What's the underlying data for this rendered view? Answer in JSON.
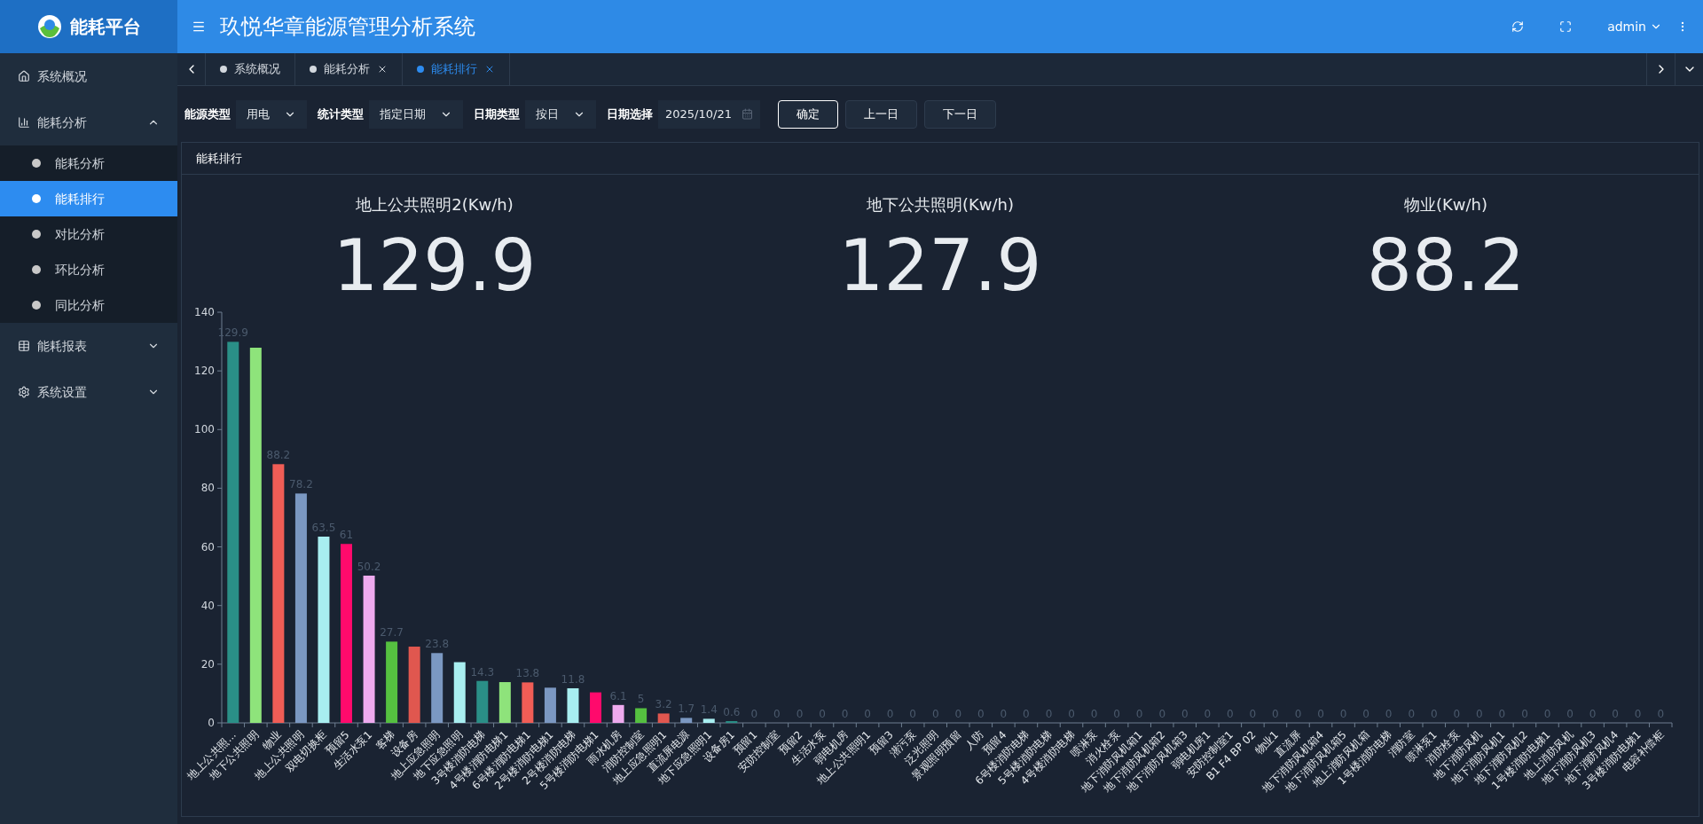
{
  "logo": {
    "text": "能耗平台"
  },
  "header": {
    "title": "玖悦华章能源管理分析系统",
    "user": "admin"
  },
  "sidebar": {
    "items": [
      {
        "label": "系统概况"
      },
      {
        "label": "能耗分析",
        "expanded": true,
        "children": [
          {
            "label": "能耗分析",
            "selected": false
          },
          {
            "label": "能耗排行",
            "selected": true
          },
          {
            "label": "对比分析",
            "selected": false
          },
          {
            "label": "环比分析",
            "selected": false
          },
          {
            "label": "同比分析",
            "selected": false
          }
        ]
      },
      {
        "label": "能耗报表",
        "expanded": false
      },
      {
        "label": "系统设置",
        "expanded": false
      }
    ]
  },
  "tabs": [
    {
      "label": "系统概况",
      "selected": false,
      "closable": false
    },
    {
      "label": "能耗分析",
      "selected": false,
      "closable": true
    },
    {
      "label": "能耗排行",
      "selected": true,
      "closable": true
    }
  ],
  "filters": [
    {
      "label": "能源类型",
      "kind": "select",
      "value": "用电"
    },
    {
      "label": "统计类型",
      "kind": "select",
      "value": "指定日期"
    },
    {
      "label": "日期类型",
      "kind": "select",
      "value": "按日"
    },
    {
      "label": "日期选择",
      "kind": "date",
      "value": "2025/10/21"
    }
  ],
  "buttons": [
    {
      "label": "确定",
      "primary": true
    },
    {
      "label": "上一日",
      "primary": false
    },
    {
      "label": "下一日",
      "primary": false
    }
  ],
  "panel": {
    "title": "能耗排行",
    "top3": [
      {
        "name": "地上公共照明2(Kw/h)",
        "value": "129.9"
      },
      {
        "name": "地下公共照明(Kw/h)",
        "value": "127.9"
      },
      {
        "name": "物业(Kw/h)",
        "value": "88.2"
      }
    ],
    "chart_data": {
      "type": "bar",
      "categories": [
        "地上公共照...",
        "地下公共照明",
        "物业",
        "地上公共照明",
        "双电切换柜",
        "预留5",
        "生活水泵1",
        "客梯",
        "设备房",
        "地上应急照明",
        "地下应急照明",
        "3号楼消防电梯",
        "4号楼消防电梯1",
        "6号楼消防电梯1",
        "2号楼消防电梯1",
        "2号楼消防电梯",
        "5号楼消防电梯1",
        "雨水机房",
        "消防控制室",
        "地上应急照明1",
        "直流屏电源",
        "地下应急照明1",
        "设备房1",
        "预留1",
        "安防控制室",
        "预留2",
        "生活水泵",
        "弱电机房",
        "地上公共照明1",
        "预留3",
        "潜污泵",
        "泛光照明",
        "景观照明预留",
        "人防",
        "预留4",
        "6号楼消防电梯",
        "5号楼消防电梯",
        "4号楼消防电梯",
        "喷淋泵",
        "消火栓泵",
        "地下消防风机箱1",
        "地下消防风机箱2",
        "地下消防风机箱3",
        "弱电机房1",
        "安防控制室1",
        "B1 F4 BP 02",
        "物业1",
        "直流屏",
        "地下消防风机箱4",
        "地下消防风机箱5",
        "地上消防风机箱",
        "1号楼消防电梯",
        "消防室",
        "喷淋泵1",
        "消防栓泵",
        "地下消防风机",
        "地下消防风机1",
        "地下消防风机2",
        "1号楼消防电梯1",
        "地上消防风机",
        "地下消防风机3",
        "地下消防风机4",
        "3号楼消防电梯1",
        "电容补偿柜"
      ],
      "series": [
        {
          "colors": [
            "#2a8f87",
            "#8ee37b",
            "#f05d56",
            "#7b98c2",
            "#a8eef0",
            "#ff0a6c",
            "#eeaaee",
            "#55c040",
            "#e0574f",
            "#7b98c2",
            "#a8eef0",
            "#2a8f87",
            "#8ee37b",
            "#f05d56",
            "#7b98c2",
            "#a8eef0",
            "#ff0a6c",
            "#eeaaee",
            "#55c040",
            "#e0574f",
            "#7b98c2",
            "#a8eef0",
            "#2a8f87",
            "#8ee37b",
            "#f05d56",
            "#7b98c2",
            "#a8eef0",
            "#ff0a6c",
            "#eeaaee",
            "#55c040",
            "#e0574f",
            "#7b98c2",
            "#a8eef0",
            "#2a8f87",
            "#8ee37b",
            "#f05d56",
            "#7b98c2",
            "#a8eef0",
            "#ff0a6c",
            "#eeaaee",
            "#55c040",
            "#e0574f",
            "#7b98c2",
            "#a8eef0",
            "#2a8f87",
            "#8ee37b",
            "#f05d56",
            "#7b98c2",
            "#a8eef0",
            "#ff0a6c",
            "#eeaaee",
            "#55c040",
            "#e0574f",
            "#7b98c2",
            "#a8eef0",
            "#2a8f87",
            "#8ee37b",
            "#f05d56",
            "#7b98c2",
            "#a8eef0",
            "#ff0a6c",
            "#eeaaee",
            "#55c040",
            "#e0574f"
          ],
          "values": [
            129.9,
            127.9,
            88.2,
            78.2,
            63.5,
            61,
            50.2,
            27.7,
            26.0,
            23.8,
            20.7,
            14.3,
            13.9,
            13.8,
            12.0,
            11.8,
            10.4,
            6.1,
            5,
            3.2,
            1.7,
            1.4,
            0.6,
            0,
            0,
            0,
            0,
            0,
            0,
            0,
            0,
            0,
            0,
            0,
            0,
            0,
            0,
            0,
            0,
            0,
            0,
            0,
            0,
            0,
            0,
            0,
            0,
            0,
            0,
            0,
            0,
            0,
            0,
            0,
            0,
            0,
            0,
            0,
            0,
            0,
            0,
            0,
            0,
            0
          ]
        }
      ],
      "value_labels": [
        "129.9",
        null,
        "88.2",
        "78.2",
        "63.5",
        "61",
        "50.2",
        "27.7",
        null,
        "23.8",
        null,
        "14.3",
        null,
        "13.8",
        null,
        "11.8",
        null,
        "6.1",
        "5",
        "3.2",
        "1.7",
        "1.4",
        "0.6",
        "0",
        "0",
        "0",
        "0",
        "0",
        "0",
        "0",
        "0",
        "0",
        "0",
        "0",
        "0",
        "0",
        "0",
        "0",
        "0",
        "0",
        "0",
        "0",
        "0",
        "0",
        "0",
        "0",
        "0",
        "0",
        "0",
        "0",
        "0",
        "0",
        "0",
        "0",
        "0",
        "0",
        "0",
        "0",
        "0",
        "0",
        "0",
        "0",
        "0",
        "0"
      ],
      "ylim": [
        0,
        140
      ],
      "yticks": [
        0,
        20,
        40,
        60,
        80,
        100,
        120,
        140
      ]
    }
  }
}
